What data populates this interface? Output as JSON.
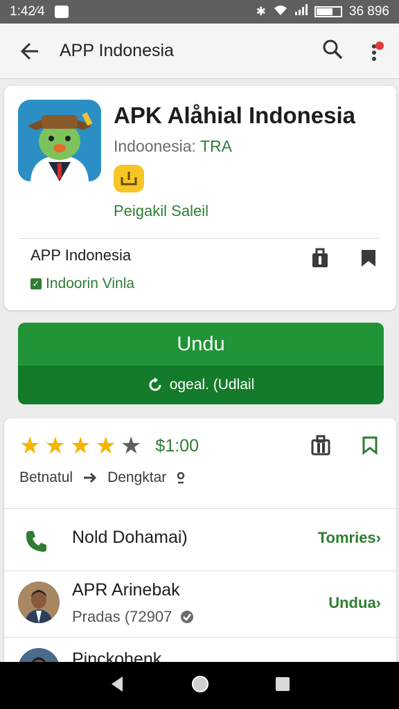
{
  "status_bar": {
    "time": "1:42⁄4",
    "battery_text": "36 896",
    "battery_level": 0.7
  },
  "app_bar": {
    "title": "APP Indonesia",
    "back_icon": "arrow-back-icon",
    "search_icon": "search-icon",
    "menu_icon": "more-vert-icon"
  },
  "app_card": {
    "name": "APK Alåhial Indonesia",
    "subtitle_prefix": "Indoonesia: ",
    "subtitle_tag": "TRA",
    "tagline": "Peigakil Saleil",
    "developer_name": "APP Indonesia",
    "developer_verified": "Indoorin Vinla"
  },
  "install": {
    "label": "Undu",
    "sub_label": "ogeal. (Udlail"
  },
  "info_card": {
    "rating": 4,
    "rating_max": 5,
    "price": "$1:00",
    "meta_left": "Betnatul",
    "meta_right": "Dengktar",
    "rows": [
      {
        "title": "Nold Dohamai)",
        "link": "Tomries›"
      },
      {
        "title": "APR Arinebak",
        "subtitle": "Pradas (72907",
        "link": "Undua›"
      },
      {
        "title": "Pinckohenk"
      }
    ]
  },
  "colors": {
    "accent_green": "#219437",
    "dark_green": "#137b2a",
    "star_gold": "#f4b400",
    "star_empty": "#5f5f5f"
  }
}
